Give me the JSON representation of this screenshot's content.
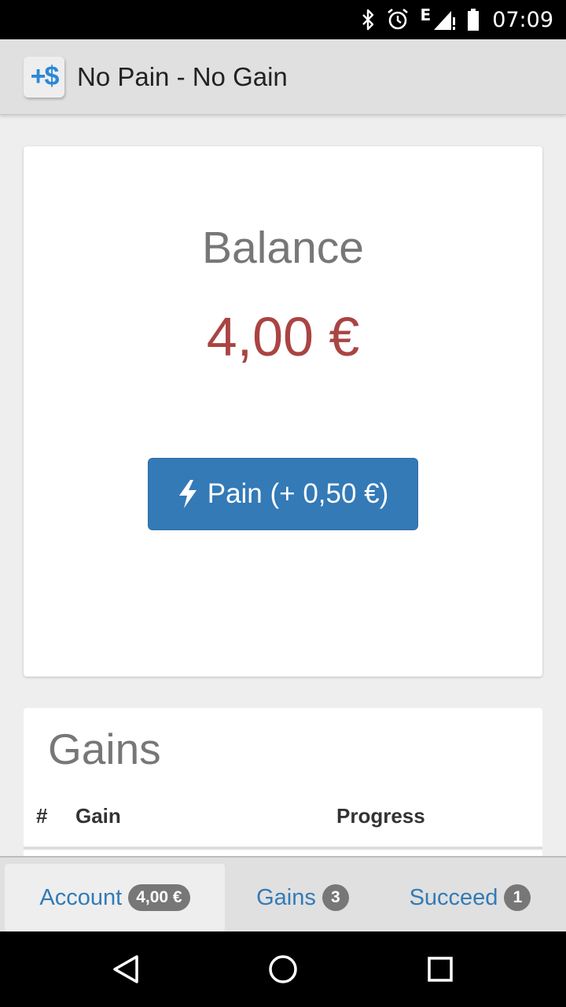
{
  "status_bar": {
    "network_label": "E",
    "time": "07:09",
    "icons": [
      "bluetooth-icon",
      "alarm-icon",
      "signal-icon",
      "battery-icon"
    ]
  },
  "app_bar": {
    "logo_text": "+$",
    "title": "No Pain - No Gain"
  },
  "balance_card": {
    "label": "Balance",
    "value": "4,00 €",
    "value_color": "#a94442",
    "pain_button": {
      "icon": "bolt-icon",
      "label": "Pain (+ 0,50 €)",
      "color": "#337ab7"
    }
  },
  "gains_card": {
    "title": "Gains",
    "columns": [
      "#",
      "Gain",
      "Progress"
    ]
  },
  "tabs": [
    {
      "label": "Account",
      "badge": "4,00 €",
      "active": true
    },
    {
      "label": "Gains",
      "badge": "3",
      "active": false
    },
    {
      "label": "Succeed",
      "badge": "1",
      "active": false
    }
  ],
  "nav_bar": {
    "buttons": [
      "back-icon",
      "home-icon",
      "recents-icon"
    ]
  },
  "colors": {
    "accent": "#337ab7",
    "badge": "#777777",
    "balance": "#a94442"
  }
}
